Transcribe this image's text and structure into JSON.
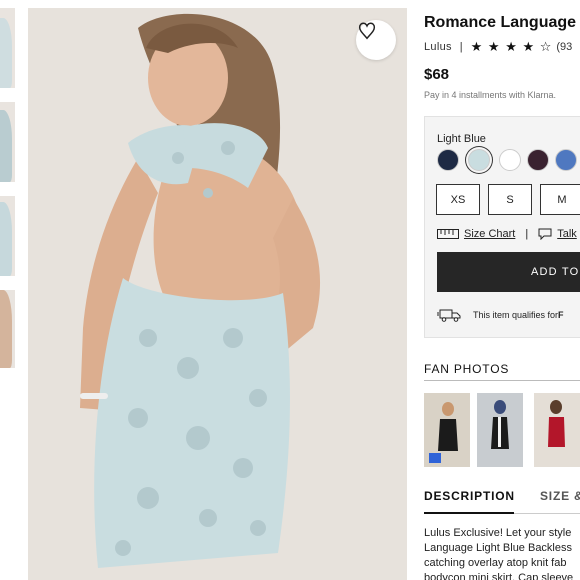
{
  "product": {
    "title": "Romance Language Light Blue Backless Lace Dress",
    "brand": "Lulus",
    "rating_stars": "★ ★ ★ ★ ☆",
    "rating_value": 4.5,
    "review_count": "(93",
    "price": "$68",
    "installments": "Pay in 4 installments with Klarna."
  },
  "color": {
    "label": "Light Blue",
    "swatches": [
      {
        "name": "navy",
        "hex": "#1e2a44",
        "selected": false
      },
      {
        "name": "light blue",
        "hex": "#c9dde0",
        "selected": true
      },
      {
        "name": "white",
        "hex": "#ffffff",
        "selected": false
      },
      {
        "name": "burgundy",
        "hex": "#3a2230",
        "selected": false
      },
      {
        "name": "blue",
        "hex": "#4f78c0",
        "selected": false
      }
    ]
  },
  "sizes": [
    "XS",
    "S",
    "M"
  ],
  "links": {
    "size_chart": "Size Chart",
    "talk": "Talk"
  },
  "cart": {
    "add_label": "ADD TO"
  },
  "shipping": {
    "text": "This item qualifies for ",
    "bold": "F"
  },
  "fan_photos": {
    "title": "FAN PHOTOS"
  },
  "tabs": {
    "description": "DESCRIPTION",
    "size_fit": "SIZE &"
  },
  "description": {
    "lines": [
      "Lulus Exclusive! Let your style",
      "Language Light Blue Backless",
      "catching overlay atop knit fab",
      "bodycon mini skirt. Cap sleeve"
    ]
  },
  "icons": {
    "favorite": "heart-icon",
    "size_chart": "ruler-icon",
    "talk": "chat-icon",
    "shipping": "truck-icon"
  }
}
